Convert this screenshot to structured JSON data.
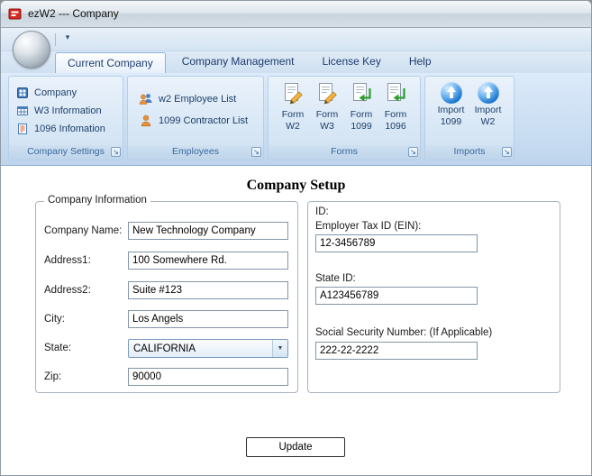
{
  "window": {
    "title": "ezW2 --- Company"
  },
  "icons": {
    "qat_dropdown": "▾",
    "combo_arrow": "▼",
    "dialog_launcher": "↘"
  },
  "tabs": [
    {
      "label": "Current Company"
    },
    {
      "label": "Company Management"
    },
    {
      "label": "License Key"
    },
    {
      "label": "Help"
    }
  ],
  "groups": {
    "company_settings": {
      "label": "Company Settings",
      "items": [
        {
          "label": "Company"
        },
        {
          "label": "W3 Information"
        },
        {
          "label": "1096 Infomation"
        }
      ]
    },
    "employees": {
      "label": "Employees",
      "items": [
        {
          "label": "w2 Employee List"
        },
        {
          "label": "1099 Contractor List"
        }
      ]
    },
    "forms": {
      "label": "Forms",
      "items": [
        {
          "line1": "Form",
          "line2": "W2"
        },
        {
          "line1": "Form",
          "line2": "W3"
        },
        {
          "line1": "Form",
          "line2": "1099"
        },
        {
          "line1": "Form",
          "line2": "1096"
        }
      ]
    },
    "imports": {
      "label": "Imports",
      "items": [
        {
          "line1": "Import",
          "line2": "1099"
        },
        {
          "line1": "Import",
          "line2": "W2"
        }
      ]
    }
  },
  "content": {
    "title": "Company Setup",
    "company_info": {
      "legend": "Company Information",
      "company_name": {
        "label": "Company Name:",
        "value": "New Technology Company"
      },
      "address1": {
        "label": "Address1:",
        "value": "100 Somewhere Rd."
      },
      "address2": {
        "label": "Address2:",
        "value": "Suite #123"
      },
      "city": {
        "label": "City:",
        "value": "Los Angels"
      },
      "state": {
        "label": "State:",
        "value": "CALIFORNIA"
      },
      "zip": {
        "label": "Zip:",
        "value": "90000"
      }
    },
    "ids": {
      "legend": "ID:",
      "ein": {
        "label": "Employer Tax ID (EIN):",
        "value": "12-3456789"
      },
      "state_id": {
        "label": "State ID:",
        "value": "A123456789"
      },
      "ssn": {
        "label": "Social Security Number: (If Applicable)",
        "value": "222-22-2222"
      }
    },
    "update_button": "Update"
  }
}
